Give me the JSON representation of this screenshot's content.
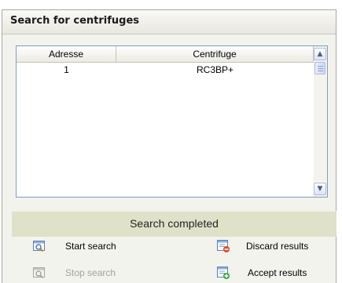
{
  "window": {
    "title": "Search for centrifuges"
  },
  "table": {
    "columns": [
      "Adresse",
      "Centrifuge"
    ],
    "rows": [
      {
        "adresse": "1",
        "centrifuge": "RC3BP+"
      }
    ]
  },
  "status": {
    "text": "Search completed",
    "color": "#dfe2c8"
  },
  "buttons": {
    "start_search": {
      "label": "Start search",
      "icon": "search-icon",
      "enabled": true
    },
    "stop_search": {
      "label": "Stop search",
      "icon": "search-icon",
      "enabled": false
    },
    "discard_results": {
      "label": "Discard results",
      "icon": "discard-icon",
      "enabled": true
    },
    "accept_results": {
      "label": "Accept results",
      "icon": "accept-icon",
      "enabled": true
    }
  },
  "icons": {
    "scroll_up": "▲",
    "scroll_down": "▼"
  }
}
